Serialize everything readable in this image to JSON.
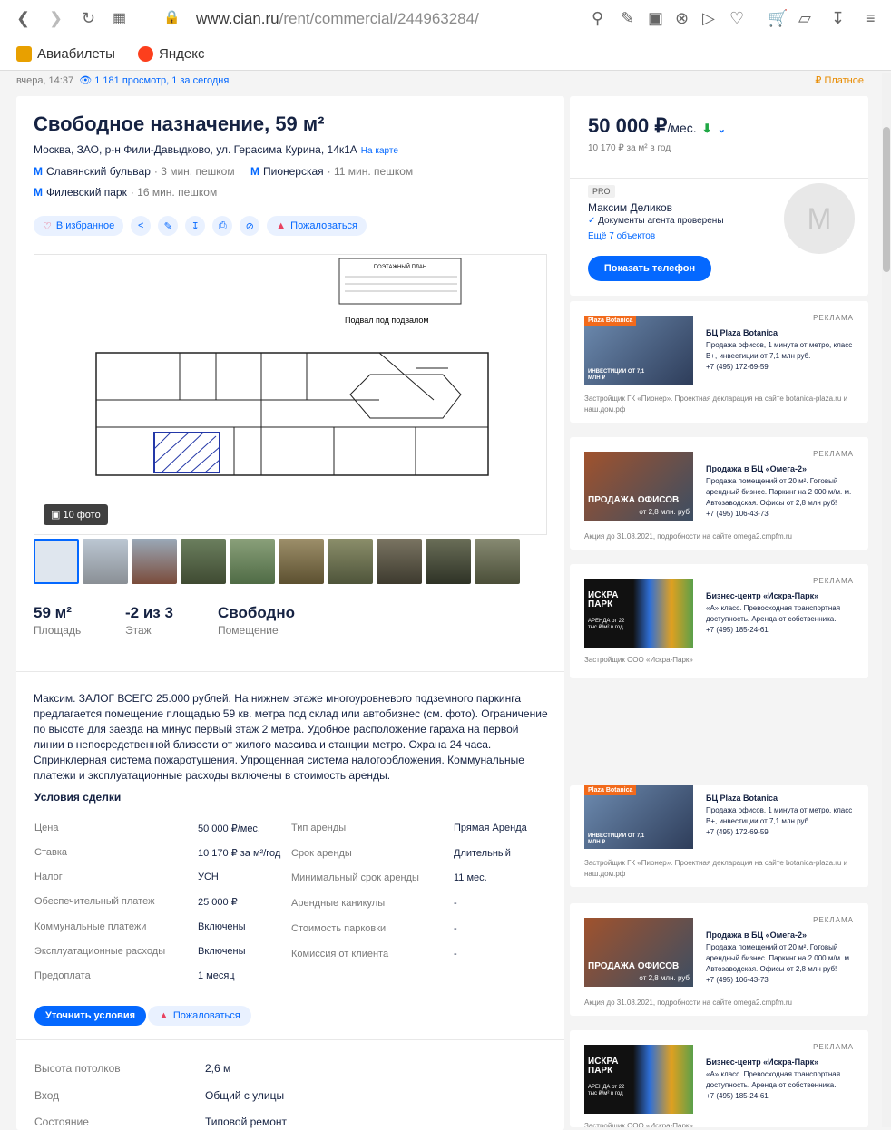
{
  "browser": {
    "url_host": "www.cian.ru",
    "url_path": "/rent/commercial/244963284/",
    "bookmarks": [
      "Авиабилеты",
      "Яндекс"
    ]
  },
  "meta": {
    "posted": "вчера, 14:37",
    "views": "1 181 просмотр, 1 за сегодня",
    "paid": "₽ Платное"
  },
  "listing": {
    "title": "Свободное назначение, 59 м²",
    "address": "Москва, ЗАО, р-н Фили-Давыдково, ул. Герасима Курина, 14к1А",
    "map_link": "На карте",
    "metro": [
      {
        "name": "Славянский бульвар",
        "time": "· 3 мин. пешком"
      },
      {
        "name": "Пионерская",
        "time": "· 11 мин. пешком"
      },
      {
        "name": "Филевский парк",
        "time": "· 16 мин. пешком"
      }
    ],
    "actions": {
      "favorite": "В избранное",
      "complain": "Пожаловаться"
    },
    "photo_count": "10 фото",
    "plan_title": "Подвал под подвалом",
    "plan_header": "ПОЭТАЖНЫЙ ПЛАН",
    "specs": [
      {
        "value": "59 м²",
        "label": "Площадь"
      },
      {
        "value": "-2 из 3",
        "label": "Этаж"
      },
      {
        "value": "Свободно",
        "label": "Помещение"
      }
    ],
    "description": "Максим. ЗАЛОГ ВСЕГО 25.000 рублей. На нижнем этаже многоуровневого подземного паркинга предлагается помещение площадью 59 кв. метра под склад или автобизнес (см. фото). Ограничение по высоте для заезда на минус первый этаж 2 метра. Удобное расположение гаража на первой линии в непосредственной близости от жилого массива и станции метро. Охрана 24 часа. Спринклерная система пожаротушения. Упрощенная система налогообложения. Коммунальные платежи и эксплуатационные расходы включены в стоимость аренды."
  },
  "terms": {
    "title": "Условия сделки",
    "left": [
      {
        "k": "Цена",
        "v": "50 000 ₽/мес."
      },
      {
        "k": "Ставка",
        "v": "10 170 ₽ за м²/год"
      },
      {
        "k": "Налог",
        "v": "УСН"
      },
      {
        "k": "Обеспечительный платеж",
        "v": "25 000 ₽"
      },
      {
        "k": "Коммунальные платежи",
        "v": "Включены"
      },
      {
        "k": "Эксплуатационные расходы",
        "v": "Включены"
      },
      {
        "k": "Предоплата",
        "v": "1 месяц"
      }
    ],
    "right": [
      {
        "k": "Тип аренды",
        "v": "Прямая Аренда"
      },
      {
        "k": "Срок аренды",
        "v": "Длительный"
      },
      {
        "k": "Минимальный срок аренды",
        "v": "11 мес."
      },
      {
        "k": "Арендные каникулы",
        "v": "-"
      },
      {
        "k": "Стоимость парковки",
        "v": "-"
      },
      {
        "k": "Комиссия от клиента",
        "v": "-"
      }
    ],
    "clarify": "Уточнить условия",
    "complain": "Пожаловаться"
  },
  "building": [
    {
      "k": "Высота потолков",
      "v": "2,6 м"
    },
    {
      "k": "Вход",
      "v": "Общий с улицы"
    },
    {
      "k": "Состояние",
      "v": "Типовой ремонт"
    }
  ],
  "price": {
    "value": "50 000 ₽",
    "unit": "/мес.",
    "per_m2": "10 170 ₽ за м² в год"
  },
  "agent": {
    "badge": "PRO",
    "name": "Максим Деликов",
    "docs": "Документы агента проверены",
    "more": "Ещё 7 объектов",
    "initial": "M",
    "phone_button": "Показать телефон"
  },
  "ads": [
    {
      "tag": "РЕКЛАМА",
      "img_label": "Plaza Botanica",
      "img_sub": "ИНВЕСТИЦИИ ОТ 7,1 МЛН ₽",
      "title": "БЦ Plaza Botanica",
      "text": "Продажа офисов, 1 минута от метро, класс В+, инвестиции от 7,1 млн руб.",
      "phone": "+7 (495) 172-69-59",
      "footer": "Застройщик ГК «Пионер». Проектная декларация на сайте botanica-plaza.ru и наш.дом.рф"
    },
    {
      "tag": "РЕКЛАМА",
      "img_label": "ПРОДАЖА ОФИСОВ",
      "img_sub": "от 2,8 млн. руб",
      "title": "Продажа в БЦ «Омега-2»",
      "text": "Продажа помещений от 20 м². Готовый арендный бизнес. Паркинг на 2 000 м/м. м. Автозаводская. Офисы от 2,8 млн руб!",
      "phone": "+7 (495) 106-43-73",
      "footer": "Акция до 31.08.2021, подробности на сайте omega2.cmpfm.ru"
    },
    {
      "tag": "РЕКЛАМА",
      "img_label": "ИСКРА ПАРК",
      "img_sub": "АРЕНДА от 22 тыс ₽/м² в год",
      "title": "Бизнес-центр «Искра-Парк»",
      "text": "«А» класс. Превосходная транспортная доступность. Аренда от собственника.",
      "phone": "+7 (495) 185-24-61",
      "footer": "Застройщик ООО «Искра-Парк»"
    }
  ],
  "colors": {
    "accent": "#0468ff",
    "text": "#152242",
    "muted": "#7a7a7a",
    "danger": "#e84260",
    "paid": "#e88b00"
  }
}
